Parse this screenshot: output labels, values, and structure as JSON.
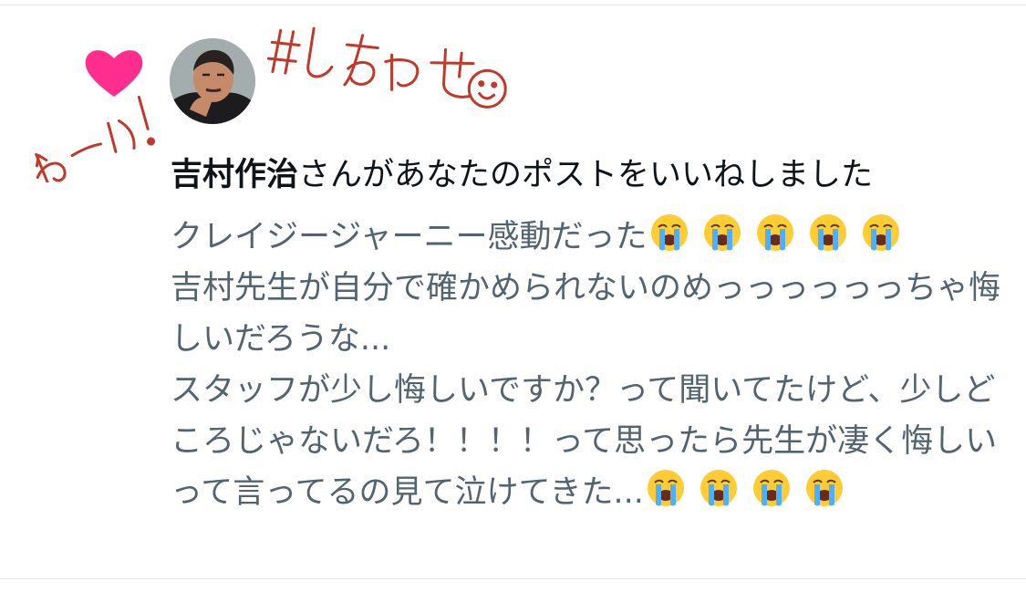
{
  "notification": {
    "user_name": "吉村作治",
    "action_text": "さんがあなたのポストをいいねしました"
  },
  "post": {
    "line1": "クレイジージャーニー感動だった",
    "line1_emoji_count": 5,
    "paragraph2": "吉村先生が自分で確かめられないのめっっっっっっちゃ悔しいだろうな...",
    "paragraph3": "スタッフが少し悔しいですか？って聞いてたけど、少しどころじゃないだろ！！！！って思ったら先生が凄く悔しいって言ってるの見て泣けてきた...",
    "paragraph3_emoji_count": 4,
    "emoji_name": "loudly-crying-face"
  },
  "stickers": {
    "hashtag": "#しあわせ",
    "exclamation": "わーい!"
  },
  "colors": {
    "primary_text": "#0f1419",
    "secondary_text": "#536471",
    "heart": "#ff2d8d",
    "stamp_outline": "#c0392b",
    "divider": "#e1e5e8"
  }
}
